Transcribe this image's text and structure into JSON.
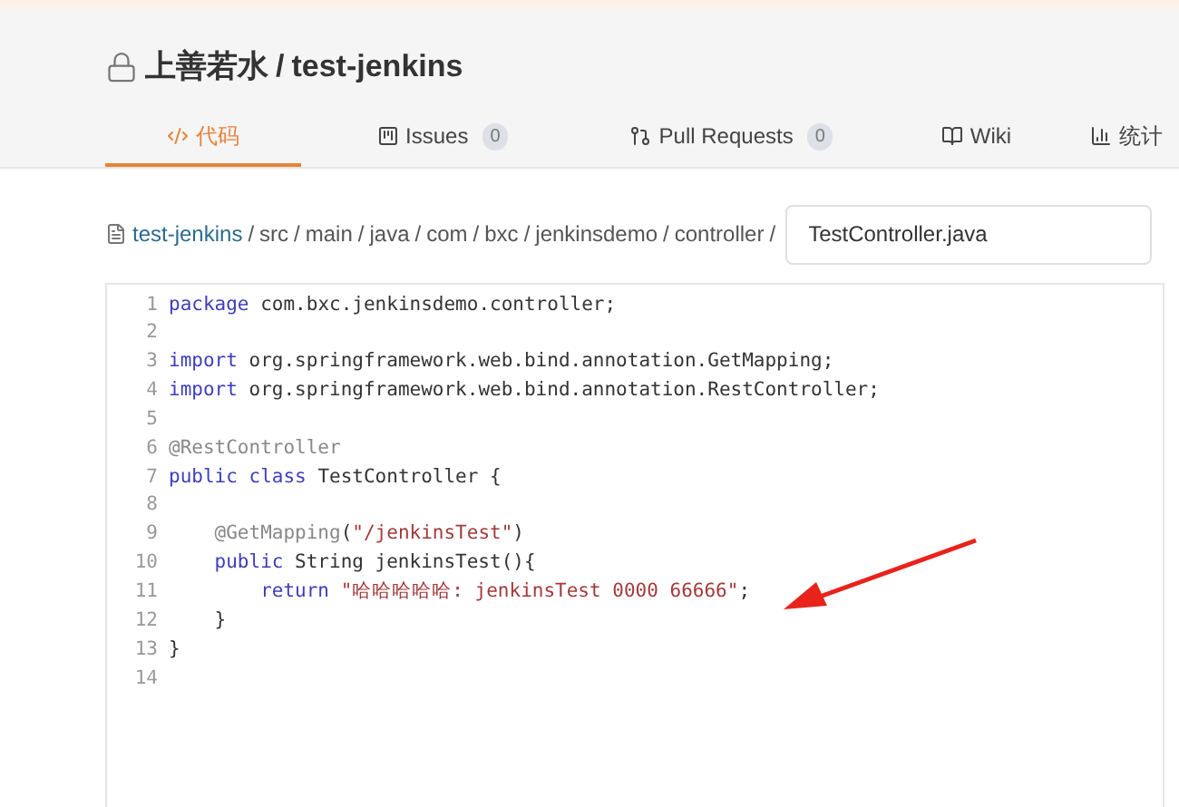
{
  "repo": {
    "owner": "上善若水",
    "separator": "/",
    "name": "test-jenkins"
  },
  "tabs": [
    {
      "kind": "code",
      "label": "代码",
      "selected": true
    },
    {
      "kind": "issues",
      "label": "Issues",
      "count": "0",
      "selected": false
    },
    {
      "kind": "pulls",
      "label": "Pull Requests",
      "count": "0",
      "selected": false
    },
    {
      "kind": "wiki",
      "label": "Wiki",
      "selected": false
    },
    {
      "kind": "stats",
      "label": "统计",
      "selected": false
    }
  ],
  "breadcrumb": {
    "root": "test-jenkins",
    "path": [
      "src",
      "main",
      "java",
      "com",
      "bxc",
      "jenkinsdemo",
      "controller"
    ],
    "separator": "/"
  },
  "file_field": {
    "value": "TestController.java"
  },
  "code": [
    {
      "number": "1",
      "kind": "top",
      "tokens": [
        {
          "kind": "keyword",
          "text": "package"
        },
        {
          "kind": "plain",
          "text": " com.bxc.jenkinsdemo.controller;"
        }
      ]
    },
    {
      "number": "2"
    },
    {
      "number": "3",
      "kind": "top",
      "tokens": [
        {
          "kind": "keyword",
          "text": "import"
        },
        {
          "kind": "plain",
          "text": " org.springframework.web.bind.annotation.GetMapping;"
        }
      ]
    },
    {
      "number": "4",
      "kind": "top",
      "tokens": [
        {
          "kind": "keyword",
          "text": "import"
        },
        {
          "kind": "plain",
          "text": " org.springframework.web.bind.annotation.RestController;"
        }
      ]
    },
    {
      "number": "5"
    },
    {
      "number": "6",
      "kind": "top",
      "tokens": [
        {
          "kind": "annotation",
          "text": "@RestController"
        }
      ]
    },
    {
      "number": "7",
      "kind": "top",
      "tokens": [
        {
          "kind": "keyword",
          "text": "public"
        },
        {
          "kind": "keyword",
          "text": " class"
        },
        {
          "kind": "plain",
          "text": " TestController {"
        }
      ]
    },
    {
      "number": "8"
    },
    {
      "number": "9",
      "kind": "member",
      "tokens": [
        {
          "kind": "annotation",
          "text": "@GetMapping"
        },
        {
          "kind": "plain",
          "text": "("
        },
        {
          "kind": "string",
          "text": "\"/jenkinsTest\""
        },
        {
          "kind": "plain",
          "text": ")"
        }
      ]
    },
    {
      "number": "10",
      "kind": "member",
      "tokens": [
        {
          "kind": "keyword",
          "text": "public"
        },
        {
          "kind": "plain",
          "text": " String jenkinsTest(){"
        }
      ]
    },
    {
      "number": "11",
      "kind": "statement",
      "tokens": [
        {
          "kind": "keyword",
          "text": "return"
        },
        {
          "kind": "string",
          "text": " \"哈哈哈哈哈: jenkinsTest 0000 66666\""
        },
        {
          "kind": "plain",
          "text": ";"
        }
      ]
    },
    {
      "number": "12",
      "kind": "member",
      "tokens": [
        {
          "kind": "plain",
          "text": "}"
        }
      ]
    },
    {
      "number": "13",
      "kind": "top",
      "tokens": [
        {
          "kind": "plain",
          "text": "}"
        }
      ]
    },
    {
      "number": "14"
    }
  ]
}
